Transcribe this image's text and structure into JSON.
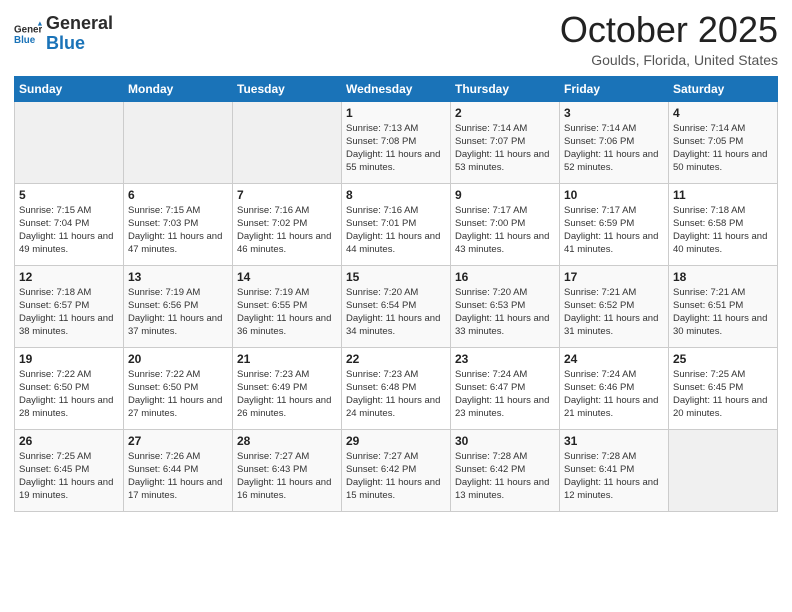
{
  "header": {
    "logo_line1": "General",
    "logo_line2": "Blue",
    "month": "October 2025",
    "location": "Goulds, Florida, United States"
  },
  "weekdays": [
    "Sunday",
    "Monday",
    "Tuesday",
    "Wednesday",
    "Thursday",
    "Friday",
    "Saturday"
  ],
  "weeks": [
    [
      {
        "day": "",
        "sunrise": "",
        "sunset": "",
        "daylight": ""
      },
      {
        "day": "",
        "sunrise": "",
        "sunset": "",
        "daylight": ""
      },
      {
        "day": "",
        "sunrise": "",
        "sunset": "",
        "daylight": ""
      },
      {
        "day": "1",
        "sunrise": "Sunrise: 7:13 AM",
        "sunset": "Sunset: 7:08 PM",
        "daylight": "Daylight: 11 hours and 55 minutes."
      },
      {
        "day": "2",
        "sunrise": "Sunrise: 7:14 AM",
        "sunset": "Sunset: 7:07 PM",
        "daylight": "Daylight: 11 hours and 53 minutes."
      },
      {
        "day": "3",
        "sunrise": "Sunrise: 7:14 AM",
        "sunset": "Sunset: 7:06 PM",
        "daylight": "Daylight: 11 hours and 52 minutes."
      },
      {
        "day": "4",
        "sunrise": "Sunrise: 7:14 AM",
        "sunset": "Sunset: 7:05 PM",
        "daylight": "Daylight: 11 hours and 50 minutes."
      }
    ],
    [
      {
        "day": "5",
        "sunrise": "Sunrise: 7:15 AM",
        "sunset": "Sunset: 7:04 PM",
        "daylight": "Daylight: 11 hours and 49 minutes."
      },
      {
        "day": "6",
        "sunrise": "Sunrise: 7:15 AM",
        "sunset": "Sunset: 7:03 PM",
        "daylight": "Daylight: 11 hours and 47 minutes."
      },
      {
        "day": "7",
        "sunrise": "Sunrise: 7:16 AM",
        "sunset": "Sunset: 7:02 PM",
        "daylight": "Daylight: 11 hours and 46 minutes."
      },
      {
        "day": "8",
        "sunrise": "Sunrise: 7:16 AM",
        "sunset": "Sunset: 7:01 PM",
        "daylight": "Daylight: 11 hours and 44 minutes."
      },
      {
        "day": "9",
        "sunrise": "Sunrise: 7:17 AM",
        "sunset": "Sunset: 7:00 PM",
        "daylight": "Daylight: 11 hours and 43 minutes."
      },
      {
        "day": "10",
        "sunrise": "Sunrise: 7:17 AM",
        "sunset": "Sunset: 6:59 PM",
        "daylight": "Daylight: 11 hours and 41 minutes."
      },
      {
        "day": "11",
        "sunrise": "Sunrise: 7:18 AM",
        "sunset": "Sunset: 6:58 PM",
        "daylight": "Daylight: 11 hours and 40 minutes."
      }
    ],
    [
      {
        "day": "12",
        "sunrise": "Sunrise: 7:18 AM",
        "sunset": "Sunset: 6:57 PM",
        "daylight": "Daylight: 11 hours and 38 minutes."
      },
      {
        "day": "13",
        "sunrise": "Sunrise: 7:19 AM",
        "sunset": "Sunset: 6:56 PM",
        "daylight": "Daylight: 11 hours and 37 minutes."
      },
      {
        "day": "14",
        "sunrise": "Sunrise: 7:19 AM",
        "sunset": "Sunset: 6:55 PM",
        "daylight": "Daylight: 11 hours and 36 minutes."
      },
      {
        "day": "15",
        "sunrise": "Sunrise: 7:20 AM",
        "sunset": "Sunset: 6:54 PM",
        "daylight": "Daylight: 11 hours and 34 minutes."
      },
      {
        "day": "16",
        "sunrise": "Sunrise: 7:20 AM",
        "sunset": "Sunset: 6:53 PM",
        "daylight": "Daylight: 11 hours and 33 minutes."
      },
      {
        "day": "17",
        "sunrise": "Sunrise: 7:21 AM",
        "sunset": "Sunset: 6:52 PM",
        "daylight": "Daylight: 11 hours and 31 minutes."
      },
      {
        "day": "18",
        "sunrise": "Sunrise: 7:21 AM",
        "sunset": "Sunset: 6:51 PM",
        "daylight": "Daylight: 11 hours and 30 minutes."
      }
    ],
    [
      {
        "day": "19",
        "sunrise": "Sunrise: 7:22 AM",
        "sunset": "Sunset: 6:50 PM",
        "daylight": "Daylight: 11 hours and 28 minutes."
      },
      {
        "day": "20",
        "sunrise": "Sunrise: 7:22 AM",
        "sunset": "Sunset: 6:50 PM",
        "daylight": "Daylight: 11 hours and 27 minutes."
      },
      {
        "day": "21",
        "sunrise": "Sunrise: 7:23 AM",
        "sunset": "Sunset: 6:49 PM",
        "daylight": "Daylight: 11 hours and 26 minutes."
      },
      {
        "day": "22",
        "sunrise": "Sunrise: 7:23 AM",
        "sunset": "Sunset: 6:48 PM",
        "daylight": "Daylight: 11 hours and 24 minutes."
      },
      {
        "day": "23",
        "sunrise": "Sunrise: 7:24 AM",
        "sunset": "Sunset: 6:47 PM",
        "daylight": "Daylight: 11 hours and 23 minutes."
      },
      {
        "day": "24",
        "sunrise": "Sunrise: 7:24 AM",
        "sunset": "Sunset: 6:46 PM",
        "daylight": "Daylight: 11 hours and 21 minutes."
      },
      {
        "day": "25",
        "sunrise": "Sunrise: 7:25 AM",
        "sunset": "Sunset: 6:45 PM",
        "daylight": "Daylight: 11 hours and 20 minutes."
      }
    ],
    [
      {
        "day": "26",
        "sunrise": "Sunrise: 7:25 AM",
        "sunset": "Sunset: 6:45 PM",
        "daylight": "Daylight: 11 hours and 19 minutes."
      },
      {
        "day": "27",
        "sunrise": "Sunrise: 7:26 AM",
        "sunset": "Sunset: 6:44 PM",
        "daylight": "Daylight: 11 hours and 17 minutes."
      },
      {
        "day": "28",
        "sunrise": "Sunrise: 7:27 AM",
        "sunset": "Sunset: 6:43 PM",
        "daylight": "Daylight: 11 hours and 16 minutes."
      },
      {
        "day": "29",
        "sunrise": "Sunrise: 7:27 AM",
        "sunset": "Sunset: 6:42 PM",
        "daylight": "Daylight: 11 hours and 15 minutes."
      },
      {
        "day": "30",
        "sunrise": "Sunrise: 7:28 AM",
        "sunset": "Sunset: 6:42 PM",
        "daylight": "Daylight: 11 hours and 13 minutes."
      },
      {
        "day": "31",
        "sunrise": "Sunrise: 7:28 AM",
        "sunset": "Sunset: 6:41 PM",
        "daylight": "Daylight: 11 hours and 12 minutes."
      },
      {
        "day": "",
        "sunrise": "",
        "sunset": "",
        "daylight": ""
      }
    ]
  ]
}
